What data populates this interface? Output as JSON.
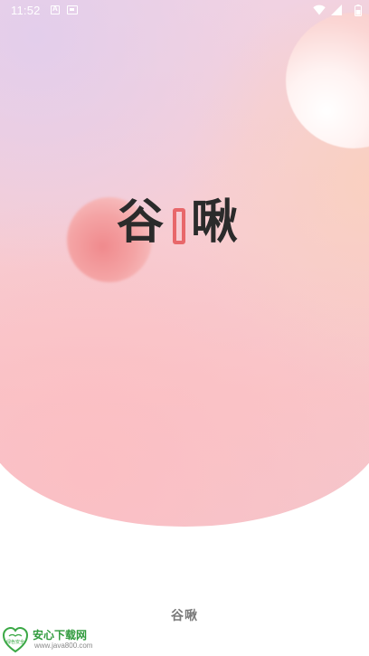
{
  "status_bar": {
    "time": "11:52",
    "icons": [
      "a-notification-icon",
      "image-notification-icon",
      "wifi-icon",
      "signal-icon",
      "battery-icon"
    ]
  },
  "splash": {
    "logo_first_char": "谷",
    "logo_last_char": "啾",
    "logo_text_color": "#2b2b2b",
    "logo_accent_color": "#e8676a",
    "app_name": "谷啾"
  },
  "watermark": {
    "title": "安心下载网",
    "url": "www.java800.com",
    "badge_text": "绿色安全",
    "color": "#2f9a3c"
  }
}
